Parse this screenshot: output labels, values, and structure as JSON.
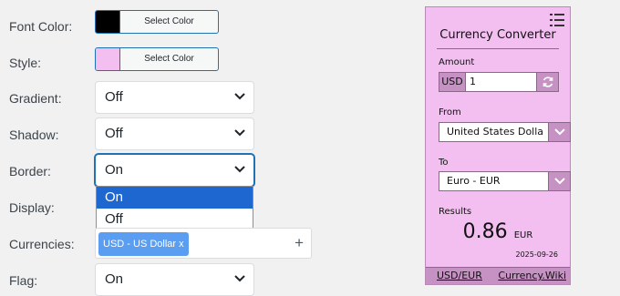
{
  "settings": {
    "font_color": {
      "label": "Font Color:",
      "button": "Select Color",
      "swatch": "#000000"
    },
    "style": {
      "label": "Style:",
      "button": "Select Color",
      "swatch": "#f2bff0"
    },
    "gradient": {
      "label": "Gradient:",
      "value": "Off"
    },
    "shadow": {
      "label": "Shadow:",
      "value": "Off"
    },
    "border": {
      "label": "Border:",
      "value": "On",
      "options": [
        "On",
        "Off"
      ]
    },
    "display": {
      "label": "Display:"
    },
    "currencies": {
      "label": "Currencies:",
      "tag": "USD - US Dollar x",
      "add": "+"
    },
    "flag": {
      "label": "Flag:",
      "value": "On"
    }
  },
  "widget": {
    "title": "Currency Converter",
    "amount_label": "Amount",
    "amount_currency": "USD",
    "amount_value": "1",
    "from_label": "From",
    "from_value": "United States Dolla",
    "to_label": "To",
    "to_value": "Euro - EUR",
    "results_label": "Results",
    "result_value": "0.86",
    "result_unit": "EUR",
    "date": "2025-09-26",
    "footer_left": "USD/EUR",
    "footer_right": "Currency.Wiki"
  },
  "colors": {
    "accent": "#2271b1",
    "dropdown_highlight": "#1e66d0",
    "widget_bg": "#f2bff0",
    "widget_dark": "#c691c3",
    "tag_bg": "#5b9df0"
  }
}
